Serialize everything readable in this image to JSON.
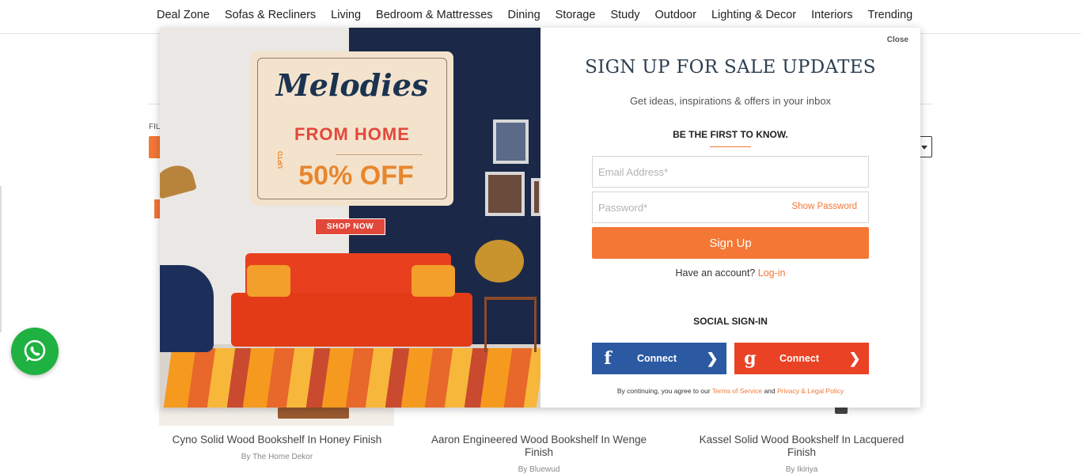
{
  "nav": {
    "items": [
      "Deal Zone",
      "Sofas & Recliners",
      "Living",
      "Bedroom & Mattresses",
      "Dining",
      "Storage",
      "Study",
      "Outdoor",
      "Lighting & Decor",
      "Interiors",
      "Trending"
    ]
  },
  "page": {
    "filter_label": "FILT"
  },
  "products": [
    {
      "name": "Cyno Solid Wood Bookshelf In Honey Finish",
      "brand": "By The Home Dekor"
    },
    {
      "name": "Aaron Engineered Wood Bookshelf In Wenge Finish",
      "brand": "By Bluewud"
    },
    {
      "name": "Kassel Solid Wood Bookshelf In Lacquered Finish",
      "brand": "By Ikiriya"
    }
  ],
  "promo": {
    "headline": "Melodies",
    "subheadline": "FROM HOME",
    "upto": "UPTO",
    "offer": "50% OFF",
    "cta": "SHOP NOW"
  },
  "modal": {
    "close_label": "Close",
    "title": "SIGN UP FOR SALE UPDATES",
    "subtitle": "Get ideas, inspirations & offers in your inbox",
    "first_to_know": "BE THE FIRST TO KNOW.",
    "email_placeholder": "Email Address*",
    "password_placeholder": "Password*",
    "show_password": "Show Password",
    "signup_label": "Sign Up",
    "have_account": "Have an account?",
    "login_link": "Log-in",
    "social_title": "SOCIAL SIGN-IN",
    "facebook_label": "Connect",
    "google_label": "Connect",
    "terms_prefix": "By continuing, you agree to our",
    "terms_link": "Terms of Service",
    "terms_and": "and",
    "privacy_link": "Privacy & Legal Policy"
  },
  "icons": {
    "facebook": "f",
    "google": "g",
    "arrow": "❯"
  },
  "colors": {
    "accent": "#f47735",
    "facebook": "#2b5aa3",
    "google": "#e94225",
    "whatsapp": "#1fb141",
    "title": "#2c3e4f"
  }
}
